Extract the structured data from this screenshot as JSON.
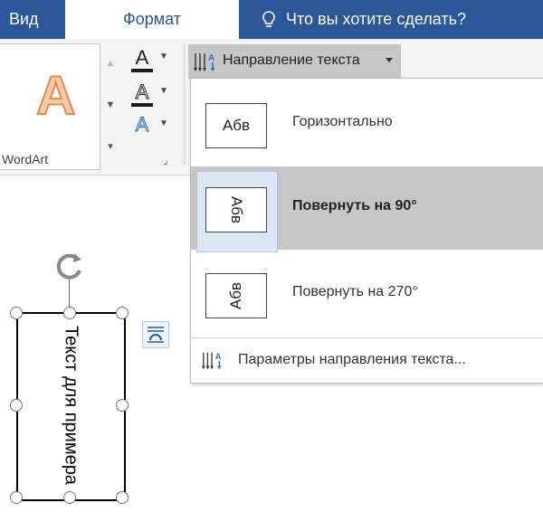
{
  "tabs": [
    {
      "label": "Вид"
    },
    {
      "label": "Формат"
    }
  ],
  "tell_me": {
    "text": "Что вы хотите сделать?"
  },
  "ribbon": {
    "gallery": {
      "preview_letter": "A",
      "accent": "#e58b4c"
    },
    "format_buttons": [
      {
        "glyph": "A",
        "icon": "text-fill-icon"
      },
      {
        "glyph": "A",
        "icon": "text-outline-icon"
      },
      {
        "glyph": "A",
        "icon": "text-effects-icon"
      }
    ],
    "group_label": "WordArt",
    "text_direction_button": {
      "label": "Направление текста"
    }
  },
  "menu": {
    "items": [
      {
        "label": "Горизонтально",
        "sample": "Абв",
        "rotation": 0,
        "selected": false
      },
      {
        "label": "Повернуть на 90°",
        "sample": "Абв",
        "rotation": 90,
        "selected": true
      },
      {
        "label": "Повернуть на 270°",
        "sample": "Абв",
        "rotation": 270,
        "selected": false
      }
    ],
    "options": {
      "label": "Параметры направления текста..."
    }
  },
  "canvas": {
    "shape_text": "Текст для примера"
  },
  "colors": {
    "brand": "#2b579a",
    "selection": "#c6c6c6"
  }
}
